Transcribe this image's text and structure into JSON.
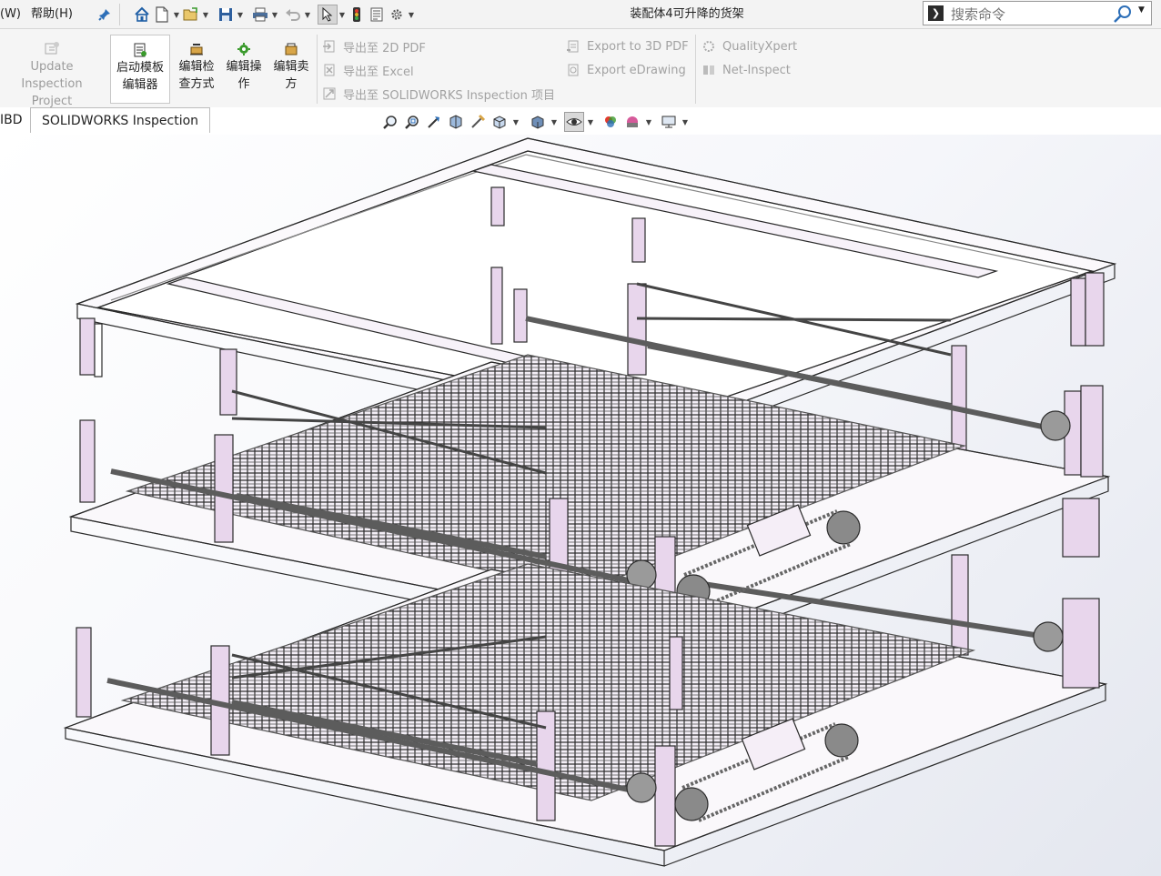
{
  "menubar": {
    "window_menu": "(W)",
    "help_menu": "帮助(H)"
  },
  "window": {
    "title": "装配体4可升降的货架"
  },
  "search": {
    "placeholder": "搜索命令"
  },
  "ribbon": {
    "update_inspection": [
      "Update Inspection",
      "Project"
    ],
    "start_template_editor": [
      "启动模板",
      "编辑器"
    ],
    "edit_inspection_method": [
      "编辑检",
      "查方式"
    ],
    "edit_operation": [
      "编辑操",
      "作"
    ],
    "edit_vendor": [
      "编辑卖",
      "方"
    ],
    "export_2d_pdf": "导出至 2D PDF",
    "export_excel": "导出至 Excel",
    "export_sw_inspection": "导出至 SOLIDWORKS Inspection 项目",
    "export_3d_pdf": "Export to 3D PDF",
    "export_edrawing": "Export eDrawing",
    "quality_xpert": "QualityXpert",
    "net_inspect": "Net-Inspect"
  },
  "tabs": {
    "mbd": "IBD",
    "sw_inspection": "SOLIDWORKS Inspection"
  },
  "colors": {
    "accent_lilac": "#e8d6ec",
    "frame_stroke": "#2b2b2b",
    "rod_gray": "#5c5c5c",
    "icon_blue": "#2d6fb8",
    "icon_green": "#3a9a2c"
  }
}
